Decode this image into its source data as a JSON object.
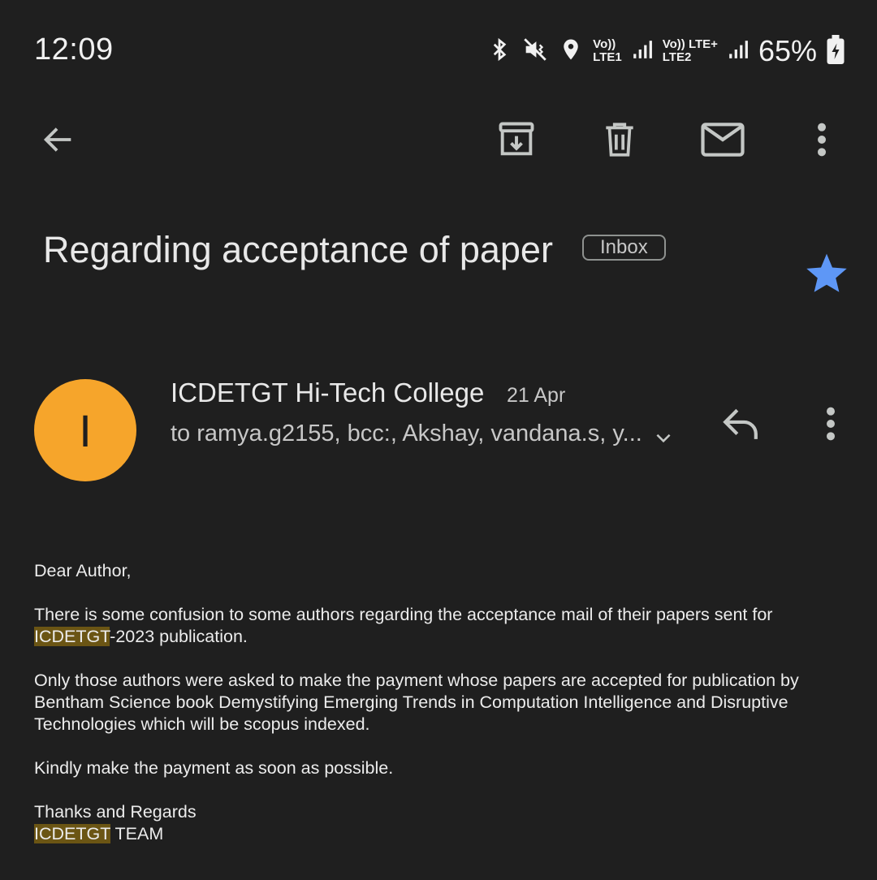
{
  "status_bar": {
    "time": "12:09",
    "sim1_top": "Vo))",
    "sim1_bottom": "LTE1",
    "sim2_top": "Vo)) LTE+",
    "sim2_bottom": "LTE2",
    "battery": "65%"
  },
  "toolbar": {
    "icons": [
      "back-arrow-icon",
      "archive-icon",
      "delete-icon",
      "mark-unread-icon",
      "more-vert-icon"
    ]
  },
  "email": {
    "subject": "Regarding acceptance of paper",
    "label": "Inbox",
    "starred": true,
    "star_color": "#5e97f6",
    "sender": {
      "initial": "I",
      "avatar_color": "#f6a52b",
      "name": "ICDETGT Hi-Tech College",
      "date": "21 Apr",
      "recipients": "to ramya.g2155, bcc:, Akshay, vandana.s, y..."
    },
    "body": {
      "greeting": "Dear Author,",
      "p1_text": "There is some confusion to some authors regarding the acceptance mail  of their papers sent for ",
      "p1_highlight": "ICDETGT",
      "p1_rest": "-2023 publication.",
      "p2": "Only those authors were asked to make the payment whose papers are accepted for publication by Bentham Science book Demystifying Emerging Trends in Computation Intelligence and Disruptive Technologies which will be scopus indexed.",
      "p3": "Kindly make the payment as soon as possible.",
      "closing": "Thanks and Regards",
      "signature_highlight": "ICDETGT",
      "signature_rest": " TEAM"
    }
  }
}
